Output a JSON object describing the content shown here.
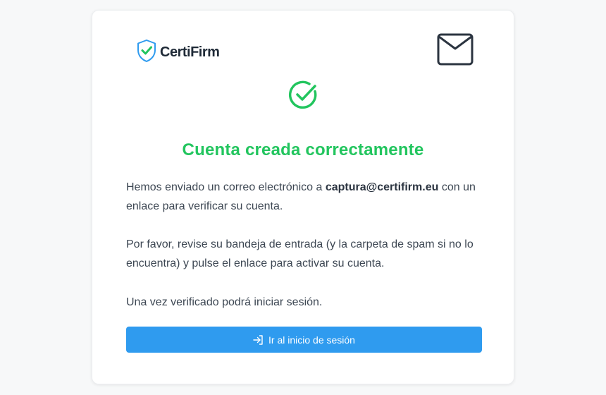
{
  "brand": {
    "name": "CertiFirm",
    "logo_icon": "shield-check-icon"
  },
  "header": {
    "mail_icon": "envelope-icon"
  },
  "status": {
    "icon": "check-circle-icon",
    "title": "Cuenta creada correctamente"
  },
  "message": {
    "p1_before": "Hemos enviado un correo electrónico a ",
    "email": "captura@certifirm.eu",
    "p1_after": " con un enlace para verificar su cuenta.",
    "p2": "Por favor, revise su bandeja de entrada (y la carpeta de spam si no lo encuentra) y pulse el enlace para activar su cuenta.",
    "p3": "Una vez verificado podrá iniciar sesión."
  },
  "action": {
    "label": "Ir al inicio de sesión",
    "icon": "login-arrow-icon"
  },
  "colors": {
    "accent_green": "#22c55e",
    "button_blue": "#2f9bef",
    "shield_blue": "#2f9bef",
    "dark_text": "#1f2a37"
  }
}
